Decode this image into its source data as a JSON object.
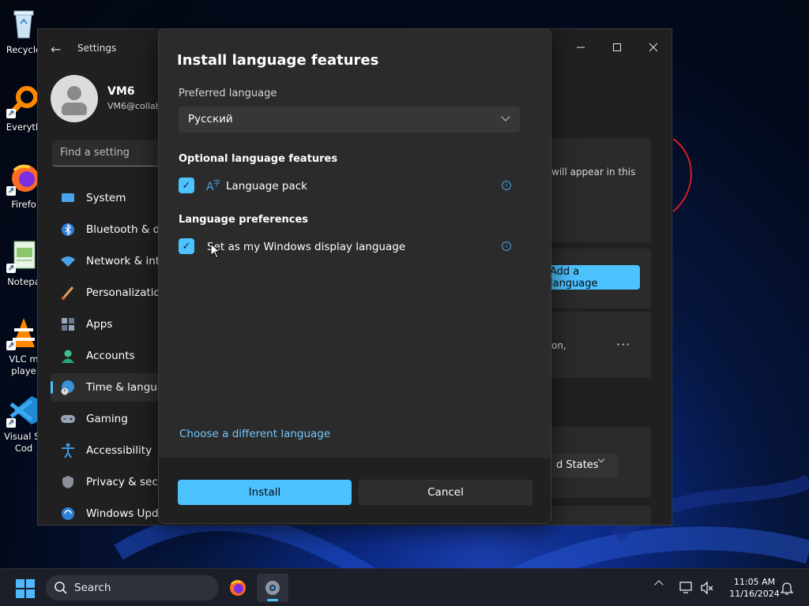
{
  "desktop": {
    "icons": [
      {
        "label": "Recycle",
        "icon": "recycle-bin-icon"
      },
      {
        "label": "Everyth",
        "icon": "everything-search-icon"
      },
      {
        "label": "Firefo",
        "icon": "firefox-icon"
      },
      {
        "label": "Notepa",
        "icon": "notepad-icon"
      },
      {
        "label": "VLC m playe",
        "icon": "vlc-icon"
      },
      {
        "label": "Visual St Cod",
        "icon": "vscode-icon"
      }
    ]
  },
  "settings": {
    "title": "Settings",
    "user": {
      "name": "VM6",
      "email": "VM6@collab"
    },
    "search_placeholder": "Find a setting",
    "nav": [
      {
        "label": "System",
        "icon": "system-icon"
      },
      {
        "label": "Bluetooth & de",
        "icon": "bluetooth-icon"
      },
      {
        "label": "Network & inte",
        "icon": "network-icon"
      },
      {
        "label": "Personalization",
        "icon": "personalization-icon"
      },
      {
        "label": "Apps",
        "icon": "apps-icon"
      },
      {
        "label": "Accounts",
        "icon": "accounts-icon"
      },
      {
        "label": "Time & langua",
        "icon": "time-language-icon",
        "active": true
      },
      {
        "label": "Gaming",
        "icon": "gaming-icon"
      },
      {
        "label": "Accessibility",
        "icon": "accessibility-icon"
      },
      {
        "label": "Privacy & secur",
        "icon": "privacy-icon"
      },
      {
        "label": "Windows Upda",
        "icon": "windows-update-icon"
      }
    ],
    "background": {
      "card1_text": "will appear in this",
      "add_language": "Add a language",
      "card3_text": "on,",
      "region_value": "d States"
    }
  },
  "dialog": {
    "title": "Install language features",
    "preferred_label": "Preferred language",
    "preferred_value": "Русский",
    "optional_heading": "Optional language features",
    "language_pack": "Language pack",
    "prefs_heading": "Language preferences",
    "display_language": "Set as my Windows display language",
    "choose_link": "Choose a different language",
    "install_button": "Install",
    "cancel_button": "Cancel"
  },
  "taskbar": {
    "search_label": "Search",
    "time": "11:05 AM",
    "date": "11/16/2024"
  },
  "colors": {
    "accent": "#4cc2ff",
    "dialog_bg": "#2b2b2b",
    "window_bg": "#202020",
    "taskbar_bg": "#1c1f27"
  }
}
